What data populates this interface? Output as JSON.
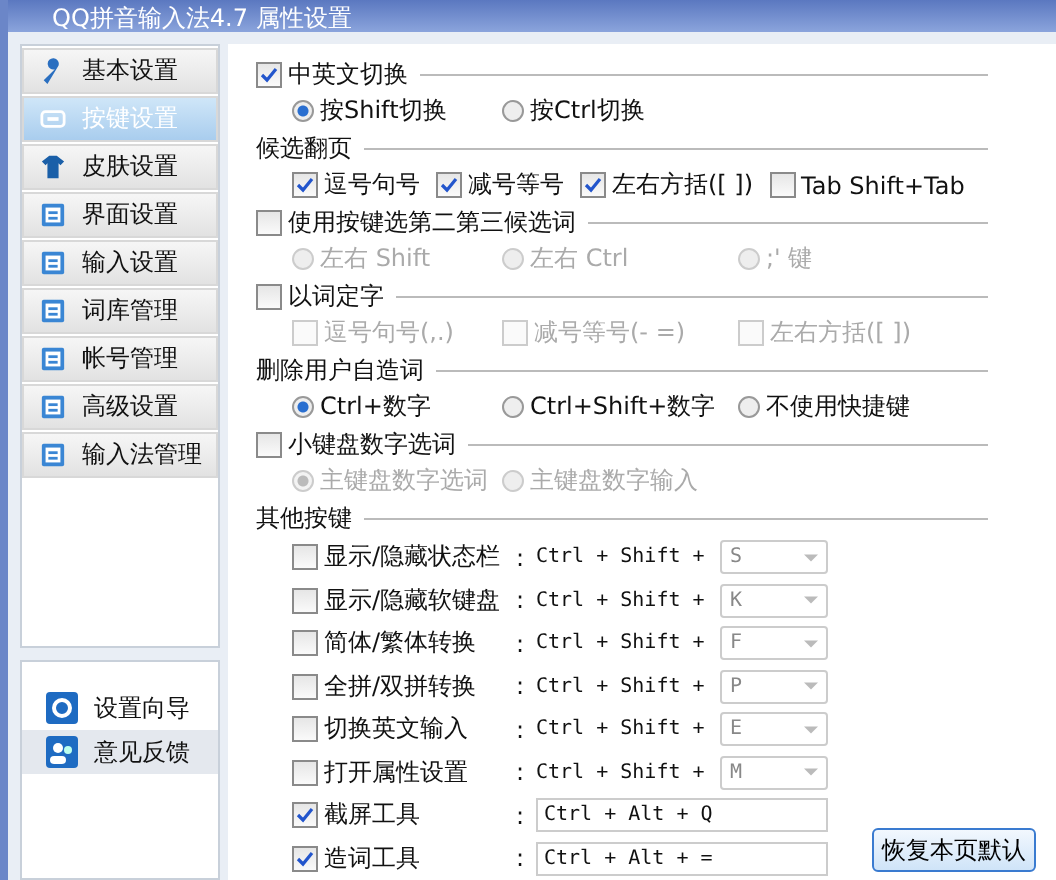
{
  "window": {
    "title": "QQ拼音输入法4.7 属性设置"
  },
  "sidebar": {
    "items": [
      {
        "label": "基本设置",
        "selected": false
      },
      {
        "label": "按键设置",
        "selected": true
      },
      {
        "label": "皮肤设置",
        "selected": false
      },
      {
        "label": "界面设置",
        "selected": false
      },
      {
        "label": "输入设置",
        "selected": false
      },
      {
        "label": "词库管理",
        "selected": false
      },
      {
        "label": "帐号管理",
        "selected": false
      },
      {
        "label": "高级设置",
        "selected": false
      },
      {
        "label": "输入法管理",
        "selected": false
      }
    ],
    "bottom_items": [
      {
        "label": "设置向导",
        "selected": false
      },
      {
        "label": "意见反馈",
        "selected": true
      }
    ]
  },
  "sections": [
    {
      "kind": "check",
      "label": "中英文切换",
      "checked": true,
      "options": [
        {
          "kind": "radio",
          "label": "按Shift切换",
          "selected": true,
          "disabled": false
        },
        {
          "kind": "radio",
          "label": "按Ctrl切换",
          "selected": false,
          "disabled": false
        }
      ]
    },
    {
      "kind": "title",
      "label": "候选翻页",
      "options": [
        {
          "kind": "checkbox",
          "label": "逗号句号",
          "checked": true,
          "disabled": false
        },
        {
          "kind": "checkbox",
          "label": "减号等号",
          "checked": true,
          "disabled": false
        },
        {
          "kind": "checkbox",
          "label": "左右方括([ ])",
          "checked": true,
          "disabled": false
        },
        {
          "kind": "checkbox",
          "label": "Tab Shift+Tab",
          "checked": false,
          "disabled": false
        }
      ]
    },
    {
      "kind": "check",
      "label": "使用按键选第二第三候选词",
      "checked": false,
      "options": [
        {
          "kind": "radio",
          "label": "左右 Shift",
          "selected": false,
          "disabled": true
        },
        {
          "kind": "radio",
          "label": "左右 Ctrl",
          "selected": false,
          "disabled": true
        },
        {
          "kind": "radio",
          "label": ";' 键",
          "selected": false,
          "disabled": true
        }
      ]
    },
    {
      "kind": "check",
      "label": "以词定字",
      "checked": false,
      "options": [
        {
          "kind": "checkbox",
          "label": "逗号句号(,.)",
          "checked": false,
          "disabled": true
        },
        {
          "kind": "checkbox",
          "label": "减号等号(- =)",
          "checked": false,
          "disabled": true
        },
        {
          "kind": "checkbox",
          "label": "左右方括([ ])",
          "checked": false,
          "disabled": true
        }
      ]
    },
    {
      "kind": "title",
      "label": "删除用户自造词",
      "options": [
        {
          "kind": "radio",
          "label": "Ctrl+数字",
          "selected": true,
          "disabled": false
        },
        {
          "kind": "radio",
          "label": "Ctrl+Shift+数字",
          "selected": false,
          "disabled": false
        },
        {
          "kind": "radio",
          "label": "不使用快捷键",
          "selected": false,
          "disabled": false
        }
      ]
    },
    {
      "kind": "check",
      "label": "小键盘数字选词",
      "checked": false,
      "options": [
        {
          "kind": "radio",
          "label": "主键盘数字选词",
          "selected": true,
          "disabled": true
        },
        {
          "kind": "radio",
          "label": "主键盘数字输入",
          "selected": false,
          "disabled": true
        }
      ]
    },
    {
      "kind": "title",
      "label": "其他按键"
    }
  ],
  "hotkeys": [
    {
      "kind": "dropdown",
      "label": "显示/隐藏状态栏",
      "checked": false,
      "colon": ":",
      "combo": "Ctrl + Shift +",
      "key": "S"
    },
    {
      "kind": "dropdown",
      "label": "显示/隐藏软键盘",
      "checked": false,
      "colon": ":",
      "combo": "Ctrl + Shift +",
      "key": "K"
    },
    {
      "kind": "dropdown",
      "label": "简体/繁体转换",
      "checked": false,
      "colon": ":",
      "combo": "Ctrl + Shift +",
      "key": "F"
    },
    {
      "kind": "dropdown",
      "label": "全拼/双拼转换",
      "checked": false,
      "colon": ":",
      "combo": "Ctrl + Shift +",
      "key": "P"
    },
    {
      "kind": "dropdown",
      "label": "切换英文输入",
      "checked": false,
      "colon": ":",
      "combo": "Ctrl + Shift +",
      "key": "E"
    },
    {
      "kind": "dropdown",
      "label": "打开属性设置",
      "checked": false,
      "colon": ":",
      "combo": "Ctrl + Shift +",
      "key": "M"
    },
    {
      "kind": "text",
      "label": "截屏工具",
      "checked": true,
      "colon": ":",
      "value": "Ctrl + Alt + Q"
    },
    {
      "kind": "text",
      "label": "造词工具",
      "checked": true,
      "colon": ":",
      "value": "Ctrl + Alt + ="
    }
  ],
  "footer": {
    "button": "恢复本页默认"
  }
}
